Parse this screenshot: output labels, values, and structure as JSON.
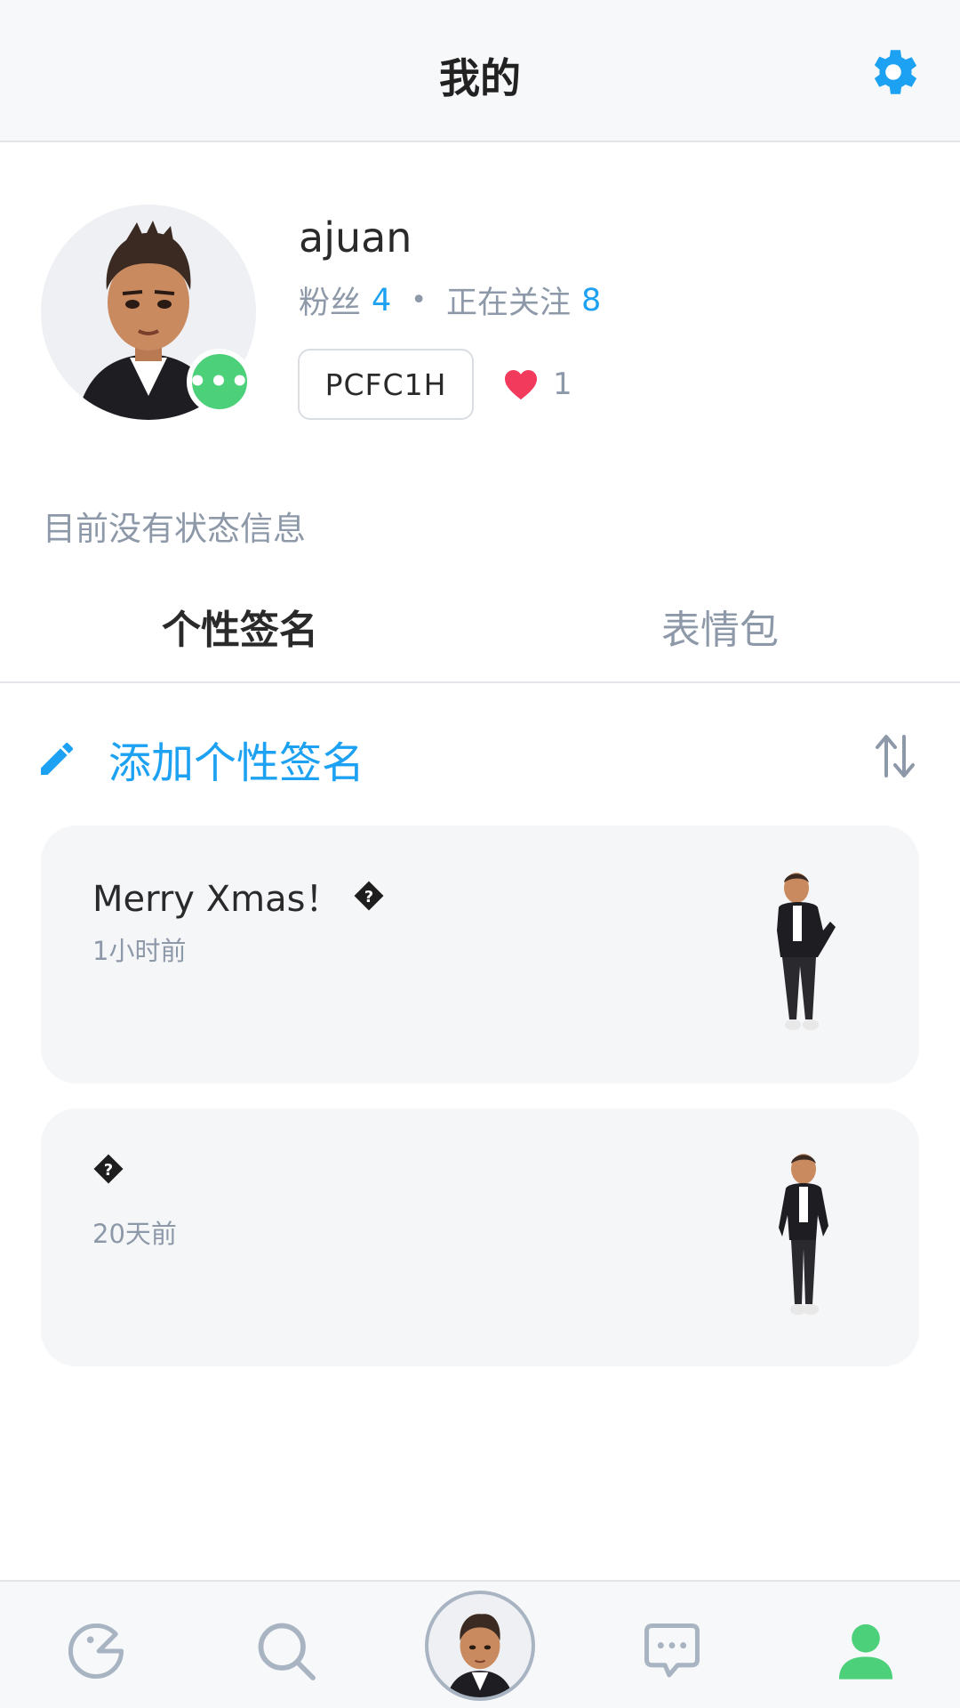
{
  "header": {
    "title": "我的"
  },
  "profile": {
    "username": "ajuan",
    "followers_label": "粉丝",
    "followers_count": "4",
    "separator": "•",
    "following_label": "正在关注",
    "following_count": "8",
    "code": "PCFC1H",
    "likes": "1",
    "status_dot_text": "•••"
  },
  "status_text": "目前没有状态信息",
  "tabs": [
    {
      "label": "个性签名",
      "active": true
    },
    {
      "label": "表情包",
      "active": false
    }
  ],
  "add_signature": {
    "label": "添加个性签名"
  },
  "signatures": [
    {
      "text": "Merry Xmas！",
      "time": "1小时前"
    },
    {
      "text": "",
      "time": "20天前"
    }
  ],
  "colors": {
    "accent": "#1da1f2",
    "online": "#4cd07a",
    "heart": "#f23a5c",
    "muted": "#8d98a8"
  },
  "bottom_nav": {
    "items": [
      "ghost-icon",
      "search-icon",
      "avatar",
      "chat-icon",
      "profile-icon"
    ],
    "active": "profile-icon"
  }
}
